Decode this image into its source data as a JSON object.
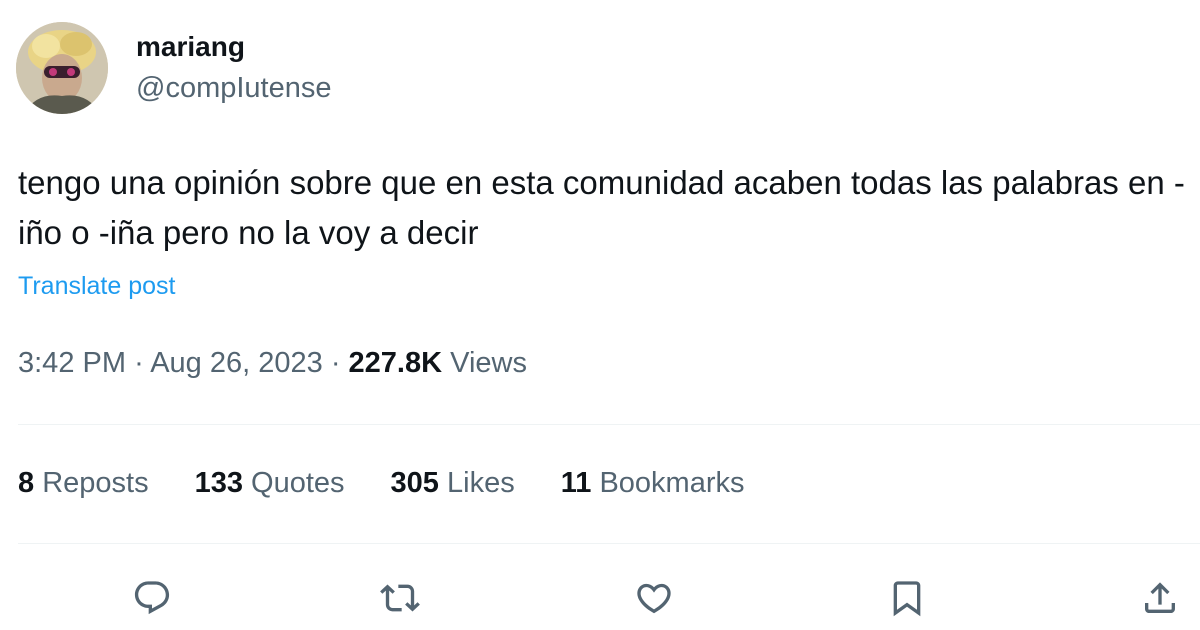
{
  "author": {
    "display_name": "mariang",
    "handle": "@compIutense"
  },
  "post": {
    "text": "tengo una opinión sobre que en esta comunidad acaben todas las palabras en -iño o -iña pero no la voy a decir",
    "translate_label": "Translate post"
  },
  "meta": {
    "time": "3:42 PM",
    "separator": "·",
    "date": "Aug 26, 2023",
    "views_count": "227.8K",
    "views_label": "Views"
  },
  "stats": [
    {
      "count": "8",
      "label": "Reposts"
    },
    {
      "count": "133",
      "label": "Quotes"
    },
    {
      "count": "305",
      "label": "Likes"
    },
    {
      "count": "11",
      "label": "Bookmarks"
    }
  ],
  "actions": {
    "reply": "reply-icon",
    "repost": "repost-icon",
    "like": "heart-icon",
    "bookmark": "bookmark-icon",
    "share": "share-icon"
  },
  "colors": {
    "text": "#0f1419",
    "secondary": "#536471",
    "link": "#1d9bf0",
    "divider": "#eff3f4"
  }
}
